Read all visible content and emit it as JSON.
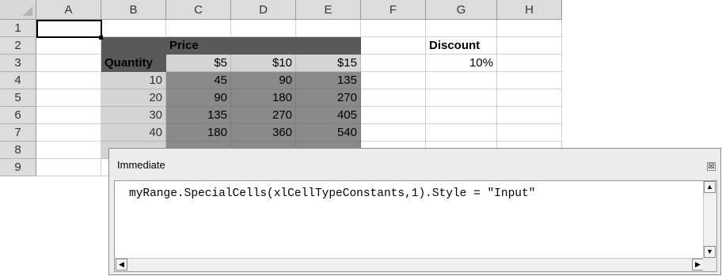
{
  "sheet": {
    "columns": [
      "A",
      "B",
      "C",
      "D",
      "E",
      "F",
      "G",
      "H"
    ],
    "rows": [
      "1",
      "2",
      "3",
      "4",
      "5",
      "6",
      "7",
      "8",
      "9"
    ],
    "price_label": "Price",
    "quantity_label": "Quantity",
    "price_headers": [
      "$5",
      "$10",
      "$15"
    ],
    "quantities": [
      "10",
      "20",
      "30",
      "40"
    ],
    "values": [
      [
        "45",
        "90",
        "135"
      ],
      [
        "90",
        "180",
        "270"
      ],
      [
        "135",
        "270",
        "405"
      ],
      [
        "180",
        "360",
        "540"
      ]
    ],
    "discount_label": "Discount",
    "discount_value": "10%"
  },
  "immediate": {
    "title": "Immediate",
    "code": "myRange.SpecialCells(xlCellTypeConstants,1).Style = \"Input\"",
    "close_glyph": "⊠",
    "up_arrow": "▲",
    "down_arrow": "▼",
    "left_arrow": "◀",
    "right_arrow": "▶"
  }
}
